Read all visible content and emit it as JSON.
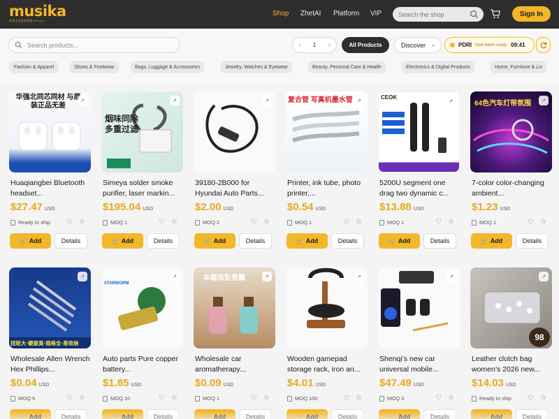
{
  "brand": {
    "name": "musika",
    "tagline": "原装正品批发商城 dzhcom"
  },
  "nav": {
    "items": [
      {
        "label": "Shop",
        "active": true
      },
      {
        "label": "ZhetAI",
        "active": false
      },
      {
        "label": "Platform",
        "active": false
      },
      {
        "label": "VIP",
        "active": false
      }
    ],
    "search_placeholder": "Search the shop",
    "signin_label": "Sign In"
  },
  "toolbar": {
    "search_placeholder": "Search products...",
    "page": "1",
    "all_products_label": "All Products",
    "discover_label": "Discover",
    "batch": {
      "code": "PDRI",
      "message": "New batch ready",
      "time": "09:41"
    }
  },
  "categories": [
    "Fashion & Apparel",
    "Shoes & Footwear",
    "Bags, Luggage & Accessories",
    "Jewelry, Watches & Eyewear",
    "Beauty, Personal Care & Health",
    "Electronics & Digital Products",
    "Home, Furniture & Liv"
  ],
  "product_labels": {
    "add": "Add",
    "details": "Details",
    "currency": "USD"
  },
  "products": [
    {
      "title": "Huaqiangbei Bluetooth headset...",
      "price": "$27.47",
      "meta": "Ready to ship",
      "img_text": "华强北同芯同材 与原装正品无差"
    },
    {
      "title": "Simeya solder smoke purifier, laser markin...",
      "price": "$195.04",
      "meta": "MOQ 1",
      "img_text": "烟味同除 多重过滤"
    },
    {
      "title": "39180-2B000 for Hyundai Auto Parts...",
      "price": "$2.00",
      "meta": "MOQ 2",
      "img_text": ""
    },
    {
      "title": "Printer, ink tube, photo printer,...",
      "price": "$0.54",
      "meta": "MOQ 1",
      "img_text": "复合管 写真机墨水管"
    },
    {
      "title": "5200U segment one drag two dynamic c...",
      "price": "$13.88",
      "meta": "MOQ 1",
      "img_text": "CEOK"
    },
    {
      "title": "7-color color-changing ambient...",
      "price": "$1.23",
      "meta": "MOQ 1",
      "img_text": "64色汽车灯带氛围"
    },
    {
      "title": "Wholesale Allen Wrench Hex Phillips...",
      "price": "$0.04",
      "meta": "MOQ 5",
      "img_text": "扭矩大·硬度高·规格全·易收纳"
    },
    {
      "title": "Auto parts Pure copper battery...",
      "price": "$1.85",
      "meta": "MOQ 10",
      "img_text": "STARWORM"
    },
    {
      "title": "Wholesale car aromatherapy...",
      "price": "$0.09",
      "meta": "MOQ 1",
      "img_text": "车载吊坠香薰"
    },
    {
      "title": "Wooden gamepad storage rack, iron an...",
      "price": "$4.01",
      "meta": "MOQ 100",
      "img_text": ""
    },
    {
      "title": "Shenqi’s new car universal mobile...",
      "price": "$47.49",
      "meta": "MOQ 3",
      "img_text": ""
    },
    {
      "title": "Leather clutch bag women’s 2026 new...",
      "price": "$14.03",
      "meta": "Ready to ship",
      "img_text": "98"
    }
  ],
  "colors": {
    "accent": "#f3b72a",
    "header_bg": "#2e2e2e",
    "price": "#e8a820"
  }
}
